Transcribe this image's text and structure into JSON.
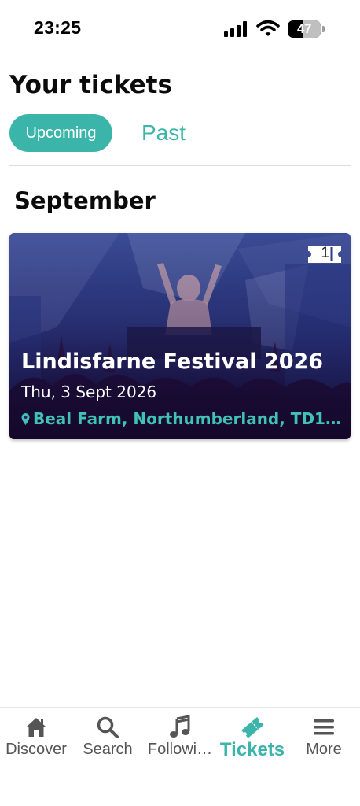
{
  "status_bar": {
    "time": "23:25",
    "battery": "47",
    "battery_level_percent": 47
  },
  "header": {
    "title": "Your tickets",
    "tabs": [
      {
        "label": "Upcoming",
        "active": true
      },
      {
        "label": "Past",
        "active": false
      }
    ]
  },
  "sections": [
    {
      "heading": "September",
      "events": [
        {
          "name": "Lindisfarne Festival 2026",
          "date": "Thu, 3 Sept 2026",
          "location": "Beal Farm, Northumberland, TD15 …",
          "ticket_count": "1"
        }
      ]
    }
  ],
  "bottom_nav": {
    "items": [
      {
        "label": "Discover",
        "icon": "home-icon",
        "active": false
      },
      {
        "label": "Search",
        "icon": "search-icon",
        "active": false
      },
      {
        "label": "Followi…",
        "icon": "music-note-icon",
        "active": false
      },
      {
        "label": "Tickets",
        "icon": "ticket-icon",
        "active": true
      },
      {
        "label": "More",
        "icon": "menu-icon",
        "active": false
      }
    ]
  },
  "colors": {
    "accent": "#3bb5aa",
    "location_text": "#42c1b6",
    "nav_inactive": "#555555"
  }
}
